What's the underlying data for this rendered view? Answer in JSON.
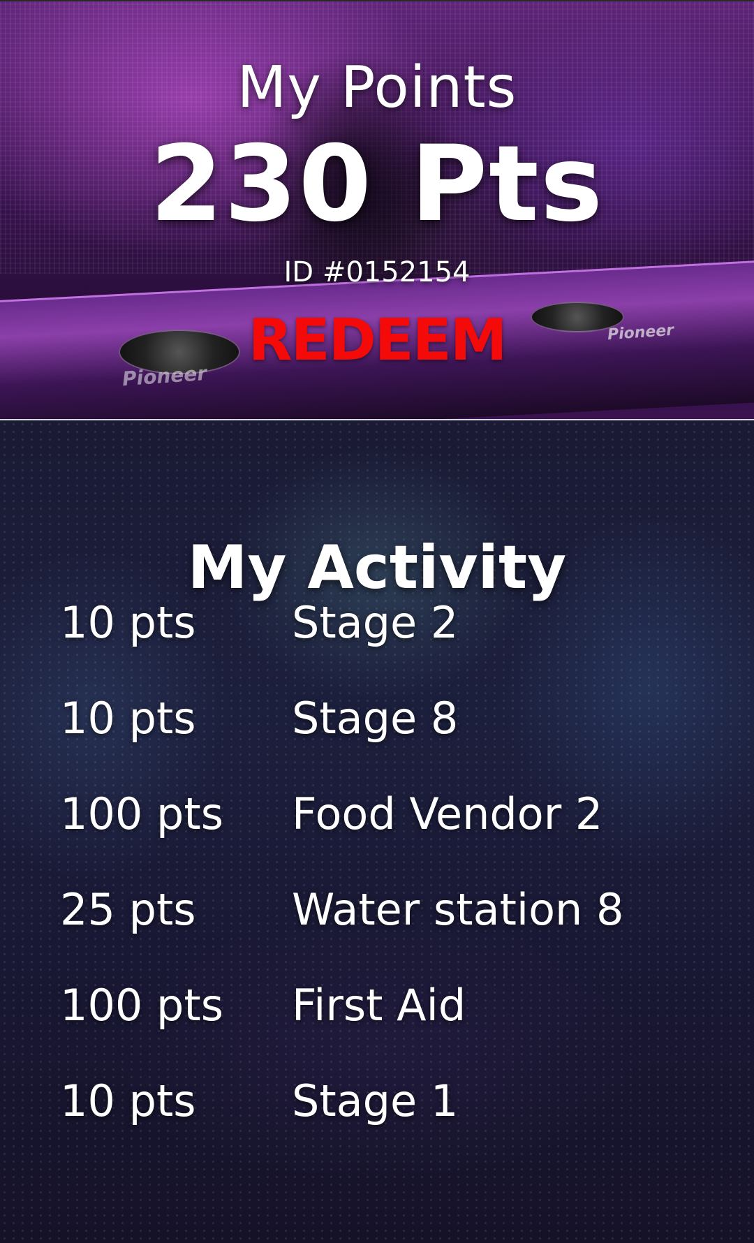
{
  "points_card": {
    "heading": "My Points",
    "total": "230 Pts",
    "member_id": "ID #0152154",
    "redeem_label": "REDEEM",
    "redeem_color": "#f50a0a",
    "background_brand_text": "Pioneer"
  },
  "activity": {
    "heading": "My Activity",
    "items": [
      {
        "points": "10 pts",
        "location": "Stage 2"
      },
      {
        "points": "10 pts",
        "location": "Stage 8"
      },
      {
        "points": "100 pts",
        "location": "Food Vendor 2"
      },
      {
        "points": "25 pts",
        "location": "Water station 8"
      },
      {
        "points": "100 pts",
        "location": "First Aid"
      },
      {
        "points": "10 pts",
        "location": "Stage 1"
      }
    ]
  }
}
